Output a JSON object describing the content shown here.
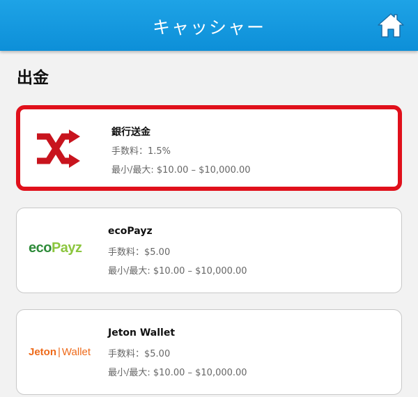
{
  "header": {
    "title": "キャッシャー",
    "home_icon": "home-icon",
    "color": "#1199de"
  },
  "section_title": "出金",
  "methods": [
    {
      "name": "銀行送金",
      "fee": "手数料：1.5%",
      "limits": "最小/最大: $10.00 – $10,000.00",
      "logo": "shuffle-arrows-icon",
      "selected": true
    },
    {
      "name": "ecoPayz",
      "fee": "手数料：$5.00",
      "limits": "最小/最大: $10.00 – $10,000.00",
      "logo_text": {
        "eco": "eco",
        "payz": "Payz"
      },
      "selected": false
    },
    {
      "name": "Jeton Wallet",
      "fee": "手数料：$5.00",
      "limits": "最小/最大: $10.00 – $10,000.00",
      "logo_text": {
        "jeton": "Jeton",
        "sep": "|",
        "wallet": "Wallet"
      },
      "selected": false
    }
  ],
  "colors": {
    "selected_border": "#e0101b",
    "eco_green": "#2e8b3a",
    "payz_green": "#8cc63f",
    "jeton_orange": "#ee6a1a",
    "bank_red": "#c8141e"
  }
}
